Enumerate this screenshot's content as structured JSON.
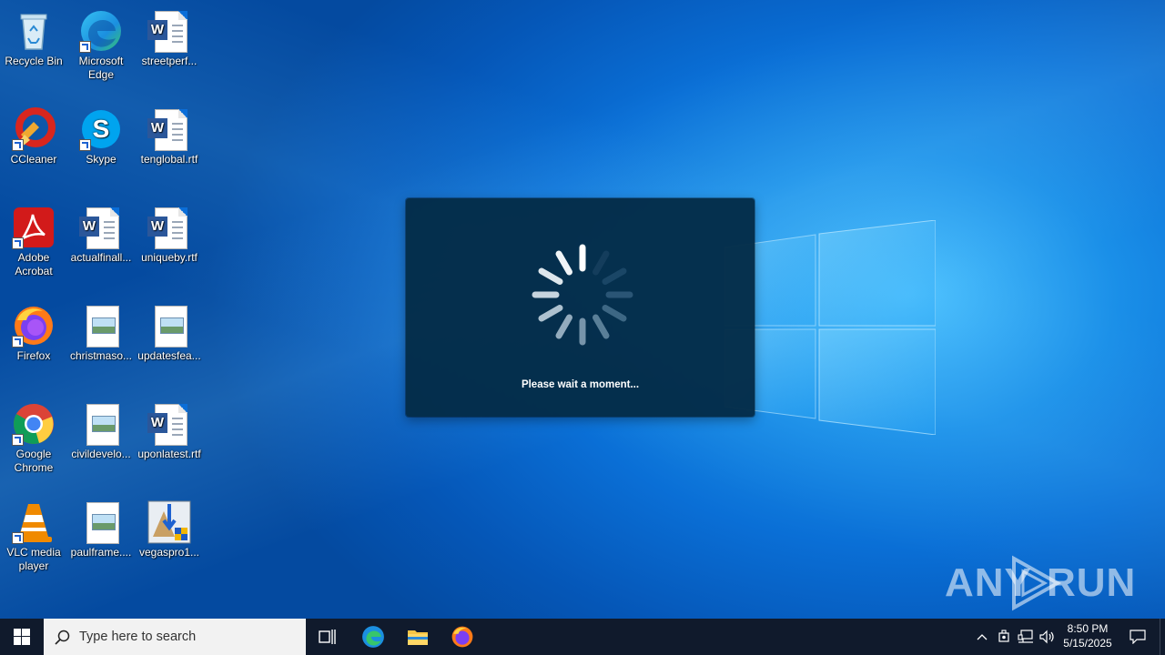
{
  "desktop": {
    "icons": [
      {
        "label": "Recycle Bin",
        "icon": "recycle-bin-icon"
      },
      {
        "label": "Microsoft Edge",
        "icon": "edge-icon"
      },
      {
        "label": "streetperf...",
        "icon": "word-doc-icon"
      },
      {
        "label": "CCleaner",
        "icon": "ccleaner-icon"
      },
      {
        "label": "Skype",
        "icon": "skype-icon"
      },
      {
        "label": "tenglobal.rtf",
        "icon": "word-doc-icon"
      },
      {
        "label": "Adobe Acrobat",
        "icon": "acrobat-icon"
      },
      {
        "label": "actualfinall...",
        "icon": "word-doc-icon"
      },
      {
        "label": "uniqueby.rtf",
        "icon": "word-doc-icon"
      },
      {
        "label": "Firefox",
        "icon": "firefox-icon"
      },
      {
        "label": "christmaso...",
        "icon": "image-file-icon"
      },
      {
        "label": "updatesfea...",
        "icon": "image-file-icon"
      },
      {
        "label": "Google Chrome",
        "icon": "chrome-icon"
      },
      {
        "label": "civildevelo...",
        "icon": "image-file-icon"
      },
      {
        "label": "uponlatest.rtf",
        "icon": "word-doc-icon"
      },
      {
        "label": "VLC media player",
        "icon": "vlc-icon"
      },
      {
        "label": "paulframe....",
        "icon": "image-file-icon"
      },
      {
        "label": "vegaspro1...",
        "icon": "installer-icon"
      }
    ]
  },
  "dialog": {
    "message": "Please wait a moment..."
  },
  "watermark": {
    "left": "ANY",
    "right": "RUN"
  },
  "taskbar": {
    "search_placeholder": "Type here to search",
    "pinned": [
      "task-view-icon",
      "edge-icon",
      "file-explorer-icon",
      "firefox-icon"
    ],
    "clock": {
      "time": "8:50 PM",
      "date": "5/15/2025"
    }
  },
  "colors": {
    "taskbar": "#101a2c",
    "dialog": "#042c48",
    "desktop_accent": "#0a6fd6"
  }
}
